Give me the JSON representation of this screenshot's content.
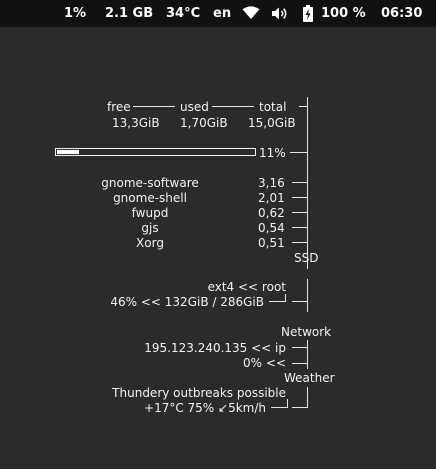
{
  "topbar": {
    "cpu": "1%",
    "memory": "2.1 GB",
    "temperature": "34°C",
    "keyboard_layout": "en",
    "battery_icon": "battery-charging-icon",
    "wifi_icon": "wifi-icon",
    "volume_icon": "volume-icon",
    "battery": "100 %",
    "clock": "06:30"
  },
  "conky": {
    "memory": {
      "headers": [
        "free",
        "used",
        "total"
      ],
      "values": [
        "13,3GiB",
        "1,70GiB",
        "15,0GiB"
      ],
      "usage_fraction": 0.11,
      "usage_label": "11%"
    },
    "processes": [
      {
        "name": "gnome-software",
        "value": "3,16"
      },
      {
        "name": "gnome-shell",
        "value": "2,01"
      },
      {
        "name": "fwupd",
        "value": "0,62"
      },
      {
        "name": "gjs",
        "value": "0,54"
      },
      {
        "name": "Xorg",
        "value": "0,51"
      }
    ],
    "ssd": {
      "title": "SSD",
      "mount": "ext4 << root",
      "usage": "46% << 132GiB / 286GiB"
    },
    "network": {
      "title": "Network",
      "ip": "195.123.240.135 << ip",
      "traffic": "0% <<"
    },
    "weather": {
      "title": "Weather",
      "summary": "Thundery outbreaks possible",
      "details": "+17°C 75% ↙5km/h"
    }
  }
}
